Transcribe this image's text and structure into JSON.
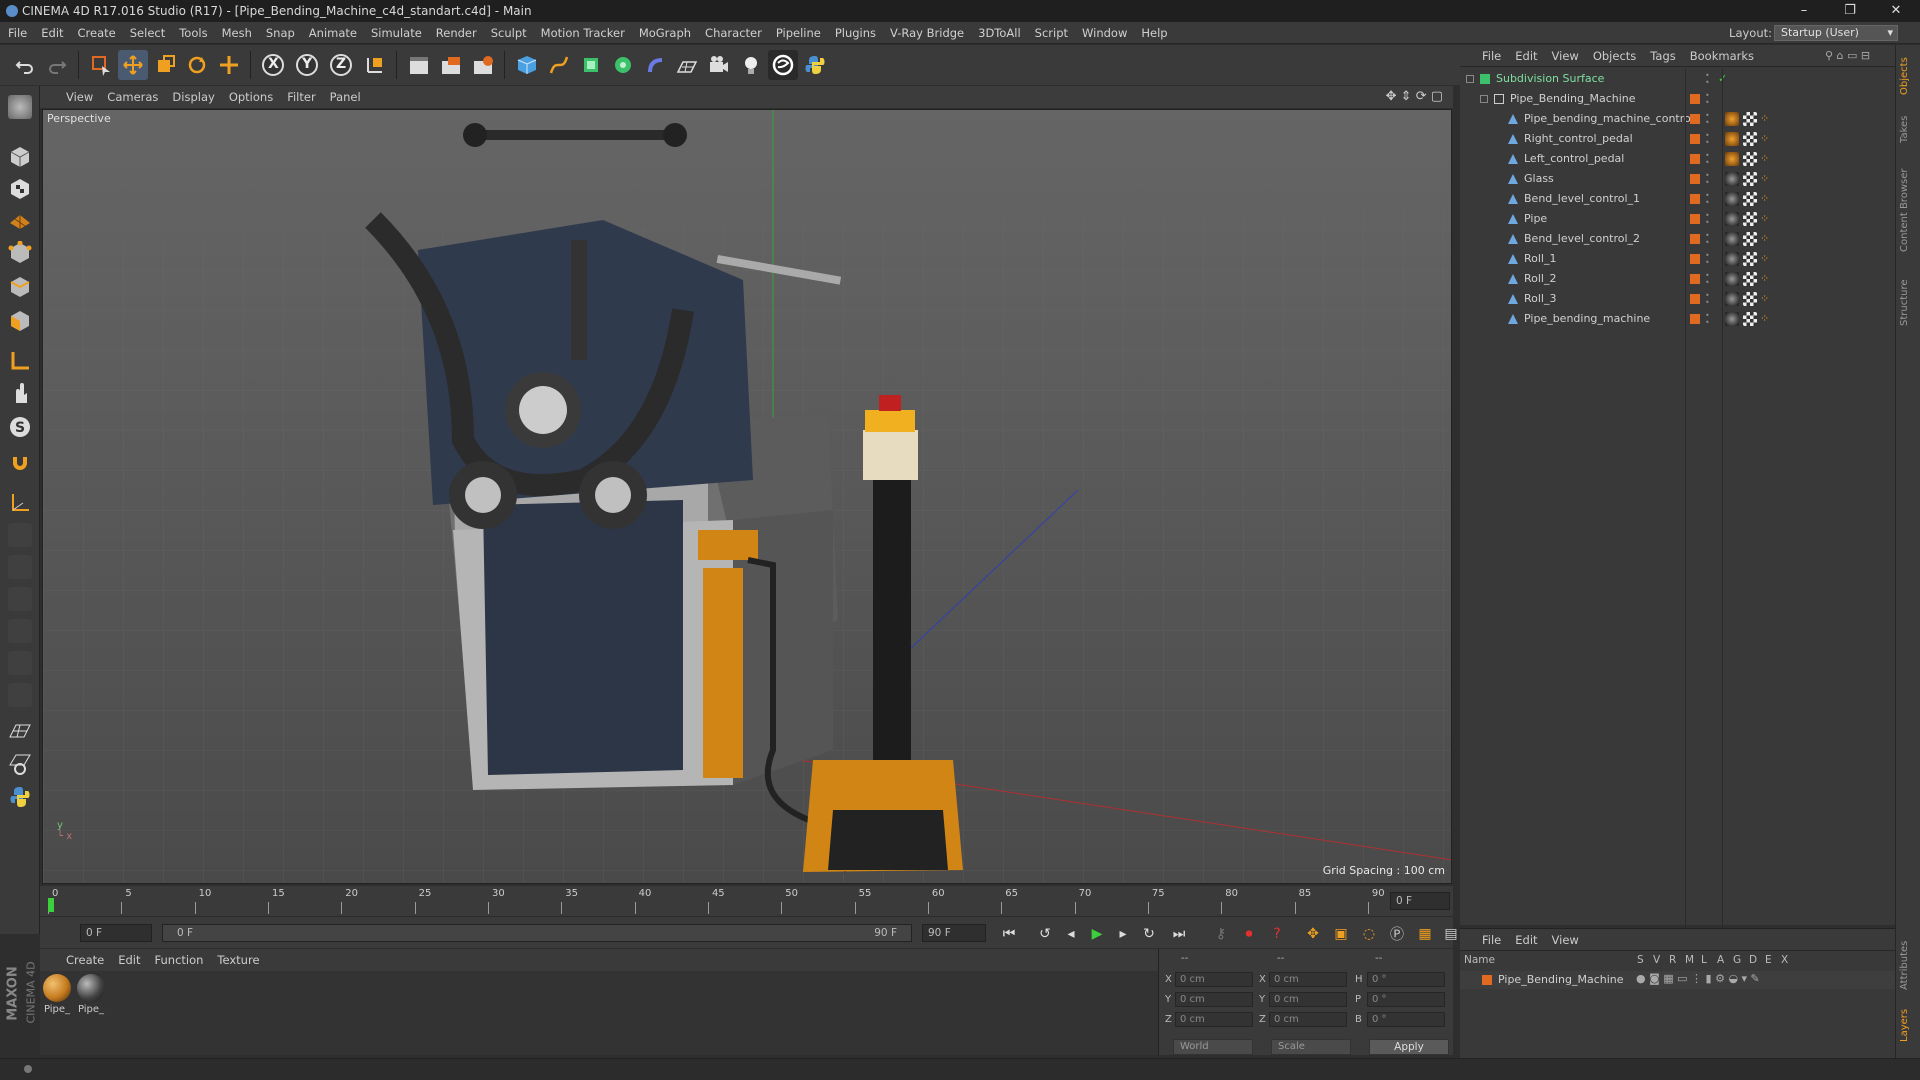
{
  "app": {
    "title": "CINEMA 4D R17.016 Studio (R17) - [Pipe_Bending_Machine_c4d_standart.c4d] - Main",
    "window_controls": [
      "–",
      "❐",
      "✕"
    ]
  },
  "menubar": {
    "items": [
      "File",
      "Edit",
      "Create",
      "Select",
      "Tools",
      "Mesh",
      "Snap",
      "Animate",
      "Simulate",
      "Render",
      "Sculpt",
      "Motion Tracker",
      "MoGraph",
      "Character",
      "Pipeline",
      "Plugins",
      "V-Ray Bridge",
      "3DToAll",
      "Script",
      "Window",
      "Help"
    ],
    "layout_label": "Layout:",
    "layout_value": "Startup (User)"
  },
  "toolbar": {
    "axis_labels": [
      "X",
      "Y",
      "Z"
    ]
  },
  "viewport": {
    "menu": [
      "View",
      "Cameras",
      "Display",
      "Options",
      "Filter",
      "Panel"
    ],
    "camera_label": "Perspective",
    "grid_spacing": "Grid Spacing : 100 cm"
  },
  "timeline": {
    "ticks": [
      "0",
      "5",
      "10",
      "15",
      "20",
      "25",
      "30",
      "35",
      "40",
      "45",
      "50",
      "55",
      "60",
      "65",
      "70",
      "75",
      "80",
      "85",
      "90"
    ],
    "current_frame": "0 F",
    "start_field": "0 F",
    "range_start": "0 F",
    "range_end": "90 F",
    "end_field": "90 F"
  },
  "materials": {
    "menu": [
      "Create",
      "Edit",
      "Function",
      "Texture"
    ],
    "items": [
      {
        "label": "Pipe_",
        "color": "#c47a1e"
      },
      {
        "label": "Pipe_",
        "color": "#444444"
      }
    ]
  },
  "coordinates": {
    "header_left": "--",
    "header_mid": "--",
    "header_right": "--",
    "rows": [
      {
        "pos_label": "X",
        "pos": "0 cm",
        "size_label": "X",
        "size": "0 cm",
        "rot_label": "H",
        "rot": "0 °"
      },
      {
        "pos_label": "Y",
        "pos": "0 cm",
        "size_label": "Y",
        "size": "0 cm",
        "rot_label": "P",
        "rot": "0 °"
      },
      {
        "pos_label": "Z",
        "pos": "0 cm",
        "size_label": "Z",
        "size": "0 cm",
        "rot_label": "B",
        "rot": "0 °"
      }
    ],
    "mode_select": "World",
    "type_select": "Scale",
    "apply_label": "Apply"
  },
  "object_manager": {
    "menu": [
      "File",
      "Edit",
      "View",
      "Objects",
      "Tags",
      "Bookmarks"
    ],
    "objects": [
      {
        "name": "Subdivision Surface",
        "indent": 0,
        "type": "subdivision"
      },
      {
        "name": "Pipe_Bending_Machine",
        "indent": 1,
        "type": "null"
      },
      {
        "name": "Pipe_bending_machine_control",
        "indent": 2,
        "type": "poly",
        "mat": "orange"
      },
      {
        "name": "Right_control_pedal",
        "indent": 2,
        "type": "poly",
        "mat": "orange"
      },
      {
        "name": "Left_control_pedal",
        "indent": 2,
        "type": "poly",
        "mat": "orange"
      },
      {
        "name": "Glass",
        "indent": 2,
        "type": "poly",
        "mat": "dark"
      },
      {
        "name": "Bend_level_control_1",
        "indent": 2,
        "type": "poly",
        "mat": "dark"
      },
      {
        "name": "Pipe",
        "indent": 2,
        "type": "poly",
        "mat": "dark"
      },
      {
        "name": "Bend_level_control_2",
        "indent": 2,
        "type": "poly",
        "mat": "dark"
      },
      {
        "name": "Roll_1",
        "indent": 2,
        "type": "poly",
        "mat": "dark"
      },
      {
        "name": "Roll_2",
        "indent": 2,
        "type": "poly",
        "mat": "dark"
      },
      {
        "name": "Roll_3",
        "indent": 2,
        "type": "poly",
        "mat": "dark"
      },
      {
        "name": "Pipe_bending_machine",
        "indent": 2,
        "type": "poly",
        "mat": "dark"
      }
    ]
  },
  "layer_manager": {
    "menu": [
      "File",
      "Edit",
      "View"
    ],
    "columns": [
      "Name",
      "S",
      "V",
      "R",
      "M",
      "L",
      "A",
      "G",
      "D",
      "E",
      "X"
    ],
    "layers": [
      {
        "name": "Pipe_Bending_Machine",
        "color": "#e06a20"
      }
    ]
  },
  "side_tabs": [
    "Objects",
    "Takes",
    "Content Browser",
    "Structure",
    "Attributes",
    "Layers"
  ],
  "branding": {
    "line1": "MAXON",
    "line2": "CINEMA 4D"
  }
}
